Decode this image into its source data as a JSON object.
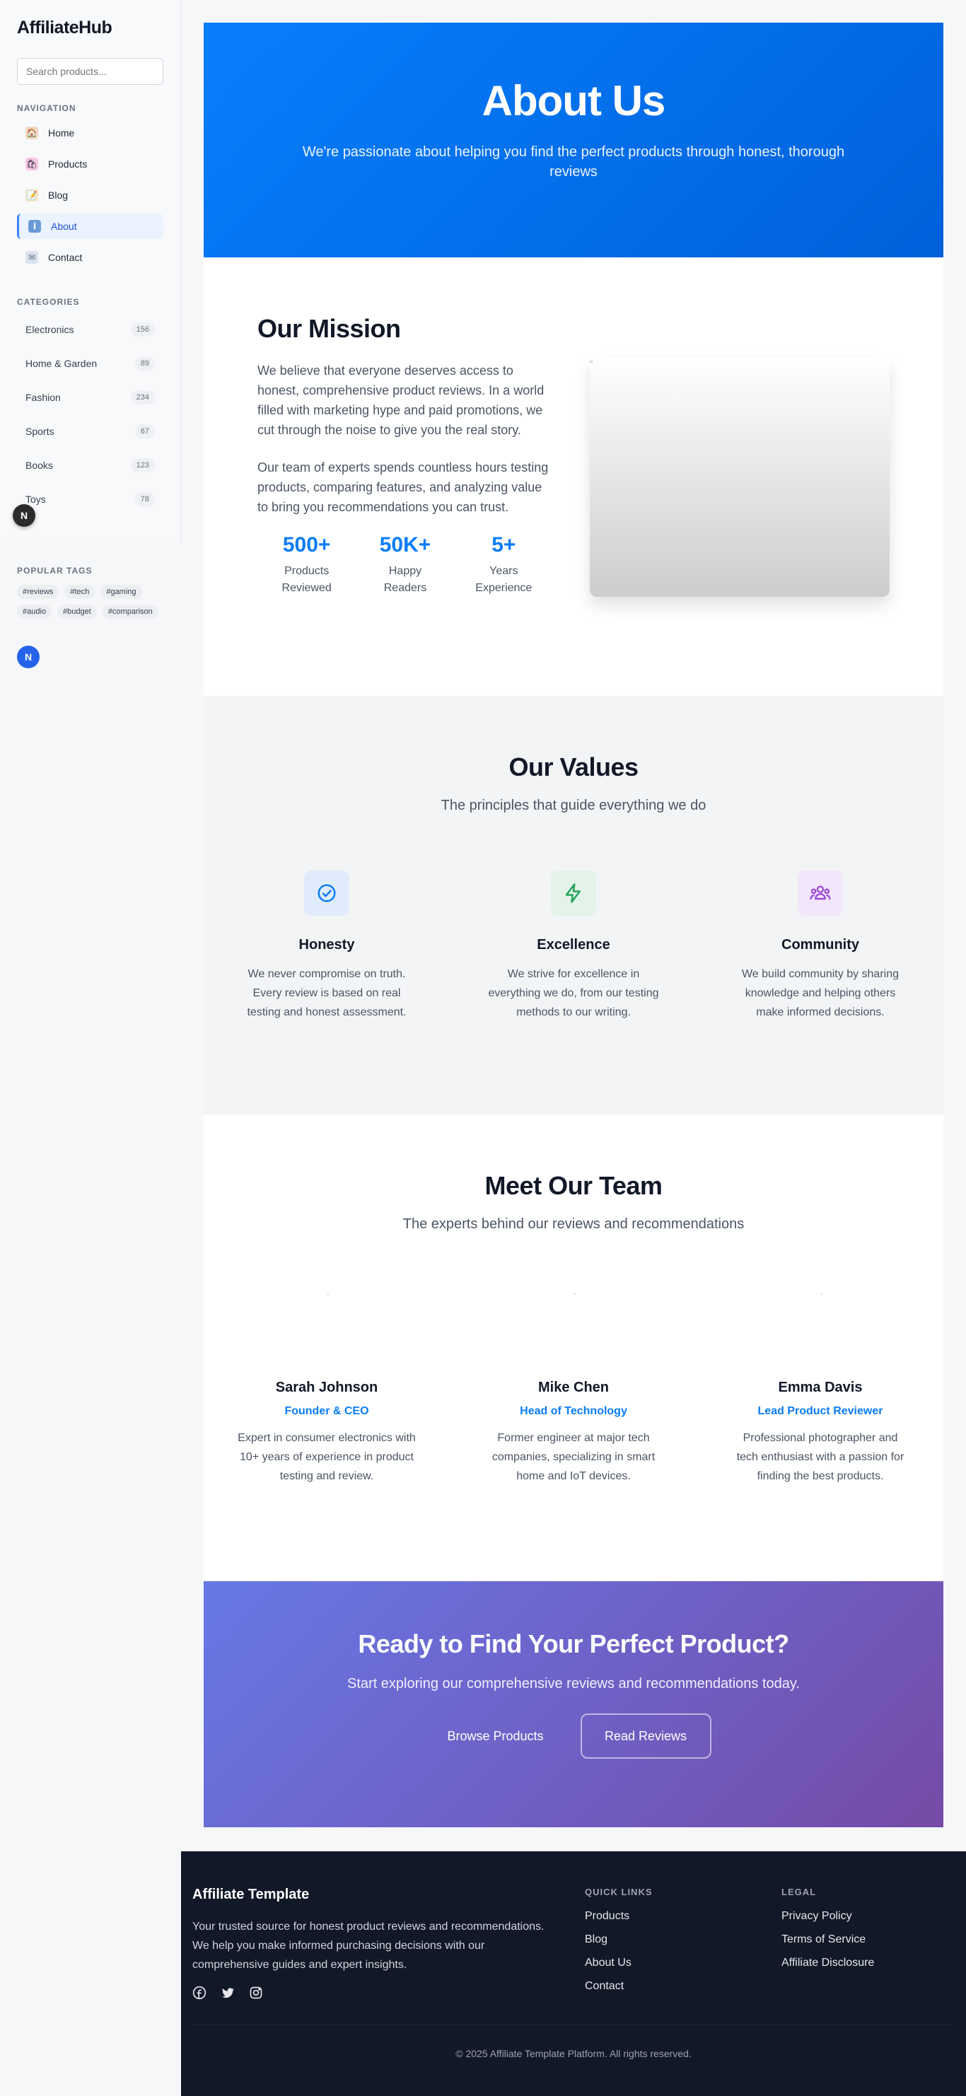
{
  "sidebar": {
    "logo": "AffiliateHub",
    "search_placeholder": "Search products...",
    "nav_label": "NAVIGATION",
    "nav": [
      {
        "label": "Home",
        "icon": "home-icon"
      },
      {
        "label": "Products",
        "icon": "shopping-bags-icon"
      },
      {
        "label": "Blog",
        "icon": "memo-icon"
      },
      {
        "label": "About",
        "icon": "info-icon",
        "active": true
      },
      {
        "label": "Contact",
        "icon": "envelope-icon"
      }
    ],
    "categories_label": "CATEGORIES",
    "categories": [
      {
        "label": "Electronics",
        "count": "156"
      },
      {
        "label": "Home & Garden",
        "count": "89"
      },
      {
        "label": "Fashion",
        "count": "234"
      },
      {
        "label": "Sports",
        "count": "67"
      },
      {
        "label": "Books",
        "count": "123"
      },
      {
        "label": "Toys",
        "count": "78"
      }
    ],
    "tags_label": "POPULAR TAGS",
    "tags": [
      "#reviews",
      "#tech",
      "#gaming",
      "#audio",
      "#budget",
      "#comparison"
    ],
    "badge_dark": "N",
    "badge_blue": "N"
  },
  "hero": {
    "title": "About Us",
    "subtitle": "We're passionate about helping you find the perfect products through honest, thorough reviews"
  },
  "mission": {
    "title": "Our Mission",
    "p1": "We believe that everyone deserves access to honest, comprehensive product reviews. In a world filled with marketing hype and paid promotions, we cut through the noise to give you the real story.",
    "p2": "Our team of experts spends countless hours testing products, comparing features, and analyzing value to bring you recommendations you can trust.",
    "stats": [
      {
        "value": "500+",
        "label": "Products Reviewed"
      },
      {
        "value": "50K+",
        "label": "Happy Readers"
      },
      {
        "value": "5+",
        "label": "Years Experience"
      }
    ]
  },
  "values": {
    "title": "Our Values",
    "subtitle": "The principles that guide everything we do",
    "items": [
      {
        "title": "Honesty",
        "text": "We never compromise on truth. Every review is based on real testing and honest assessment.",
        "icon": "check-circle-icon",
        "color": "#0a7cf6",
        "bg": "#e0ecfb"
      },
      {
        "title": "Excellence",
        "text": "We strive for excellence in everything we do, from our testing methods to our writing.",
        "icon": "lightning-icon",
        "color": "#22a55a",
        "bg": "#e3f3ea"
      },
      {
        "title": "Community",
        "text": "We build community by sharing knowledge and helping others make informed decisions.",
        "icon": "community-icon",
        "color": "#9b4fd8",
        "bg": "#f2e6fb"
      }
    ]
  },
  "team": {
    "title": "Meet Our Team",
    "subtitle": "The experts behind our reviews and recommendations",
    "members": [
      {
        "name": "Sarah Johnson",
        "role": "Founder & CEO",
        "bio": "Expert in consumer electronics with 10+ years of experience in product testing and review."
      },
      {
        "name": "Mike Chen",
        "role": "Head of Technology",
        "bio": "Former engineer at major tech companies, specializing in smart home and IoT devices."
      },
      {
        "name": "Emma Davis",
        "role": "Lead Product Reviewer",
        "bio": "Professional photographer and tech enthusiast with a passion for finding the best products."
      }
    ]
  },
  "cta": {
    "title": "Ready to Find Your Perfect Product?",
    "subtitle": "Start exploring our comprehensive reviews and recommendations today.",
    "primary": "Browse Products",
    "secondary": "Read Reviews"
  },
  "footer": {
    "brand": "Affiliate Template",
    "description": "Your trusted source for honest product reviews and recommendations. We help you make informed purchasing decisions with our comprehensive guides and expert insights.",
    "quick_label": "QUICK LINKS",
    "quick_links": [
      "Products",
      "Blog",
      "About Us",
      "Contact"
    ],
    "legal_label": "LEGAL",
    "legal_links": [
      "Privacy Policy",
      "Terms of Service",
      "Affiliate Disclosure"
    ],
    "copyright": "© 2025 Affiliate Template Platform. All rights reserved."
  },
  "colors": {
    "primary": "#0a7cf6",
    "footer_bg": "#111827",
    "cta_start": "#6778e6",
    "cta_end": "#754ba6"
  }
}
